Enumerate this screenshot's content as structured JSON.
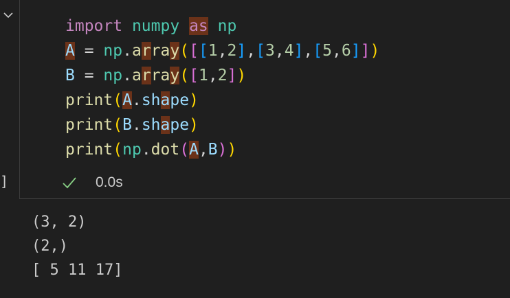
{
  "code_lines": [
    [
      {
        "t": "import",
        "c": "kw"
      },
      {
        "t": " ",
        "c": "op"
      },
      {
        "t": "numpy",
        "c": "lib"
      },
      {
        "t": " ",
        "c": "op"
      },
      {
        "t": "as",
        "c": "kw",
        "hl": true
      },
      {
        "t": " ",
        "c": "op"
      },
      {
        "t": "np",
        "c": "lib"
      }
    ],
    [
      {
        "t": "A",
        "c": "var",
        "hl": true
      },
      {
        "t": " = ",
        "c": "op"
      },
      {
        "t": "np",
        "c": "lib"
      },
      {
        "t": ".",
        "c": "op"
      },
      {
        "t": "a",
        "c": "fn"
      },
      {
        "t": "r",
        "c": "fn",
        "hl": true
      },
      {
        "t": "ra",
        "c": "fn"
      },
      {
        "t": "y",
        "c": "fn",
        "hl": true
      },
      {
        "t": "(",
        "c": "b1"
      },
      {
        "t": "[",
        "c": "b2"
      },
      {
        "t": "[",
        "c": "b3"
      },
      {
        "t": "1",
        "c": "num"
      },
      {
        "t": ",",
        "c": "op"
      },
      {
        "t": "2",
        "c": "num"
      },
      {
        "t": "]",
        "c": "b3"
      },
      {
        "t": ",",
        "c": "op"
      },
      {
        "t": "[",
        "c": "b3"
      },
      {
        "t": "3",
        "c": "num"
      },
      {
        "t": ",",
        "c": "op"
      },
      {
        "t": "4",
        "c": "num"
      },
      {
        "t": "]",
        "c": "b3"
      },
      {
        "t": ",",
        "c": "op"
      },
      {
        "t": "[",
        "c": "b3"
      },
      {
        "t": "5",
        "c": "num"
      },
      {
        "t": ",",
        "c": "op"
      },
      {
        "t": "6",
        "c": "num"
      },
      {
        "t": "]",
        "c": "b3"
      },
      {
        "t": "]",
        "c": "b2"
      },
      {
        "t": ")",
        "c": "b1"
      }
    ],
    [
      {
        "t": "B",
        "c": "var"
      },
      {
        "t": " = ",
        "c": "op"
      },
      {
        "t": "np",
        "c": "lib"
      },
      {
        "t": ".",
        "c": "op"
      },
      {
        "t": "a",
        "c": "fn"
      },
      {
        "t": "r",
        "c": "fn",
        "hl": true
      },
      {
        "t": "ra",
        "c": "fn"
      },
      {
        "t": "y",
        "c": "fn",
        "hl": true
      },
      {
        "t": "(",
        "c": "b1"
      },
      {
        "t": "[",
        "c": "b2"
      },
      {
        "t": "1",
        "c": "num"
      },
      {
        "t": ",",
        "c": "op"
      },
      {
        "t": "2",
        "c": "num"
      },
      {
        "t": "]",
        "c": "b2"
      },
      {
        "t": ")",
        "c": "b1"
      }
    ],
    [
      {
        "t": "print",
        "c": "fn"
      },
      {
        "t": "(",
        "c": "b1"
      },
      {
        "t": "A",
        "c": "var",
        "hl": true
      },
      {
        "t": ".",
        "c": "op"
      },
      {
        "t": "sh",
        "c": "var"
      },
      {
        "t": "a",
        "c": "var",
        "hl": true
      },
      {
        "t": "pe",
        "c": "var"
      },
      {
        "t": ")",
        "c": "b1"
      }
    ],
    [
      {
        "t": "print",
        "c": "fn"
      },
      {
        "t": "(",
        "c": "b1"
      },
      {
        "t": "B",
        "c": "var"
      },
      {
        "t": ".",
        "c": "op"
      },
      {
        "t": "sh",
        "c": "var"
      },
      {
        "t": "a",
        "c": "var",
        "hl": true
      },
      {
        "t": "pe",
        "c": "var"
      },
      {
        "t": ")",
        "c": "b1"
      }
    ],
    [
      {
        "t": "print",
        "c": "fn"
      },
      {
        "t": "(",
        "c": "b1"
      },
      {
        "t": "np",
        "c": "lib"
      },
      {
        "t": ".",
        "c": "op"
      },
      {
        "t": "dot",
        "c": "fn"
      },
      {
        "t": "(",
        "c": "b2"
      },
      {
        "t": "A",
        "c": "var",
        "hl": true
      },
      {
        "t": ",",
        "c": "op"
      },
      {
        "t": "B",
        "c": "var"
      },
      {
        "t": ")",
        "c": "b2"
      },
      {
        "t": ")",
        "c": "b1"
      }
    ]
  ],
  "cell_bracket": "]",
  "status": {
    "icon": "check-icon",
    "time": "0.0s",
    "color": "#89d185"
  },
  "output_lines": [
    "(3, 2)",
    "(2,)",
    "[ 5 11 17]"
  ],
  "colors": {
    "background": "#1f1f1f",
    "highlight": "#6b3219"
  }
}
